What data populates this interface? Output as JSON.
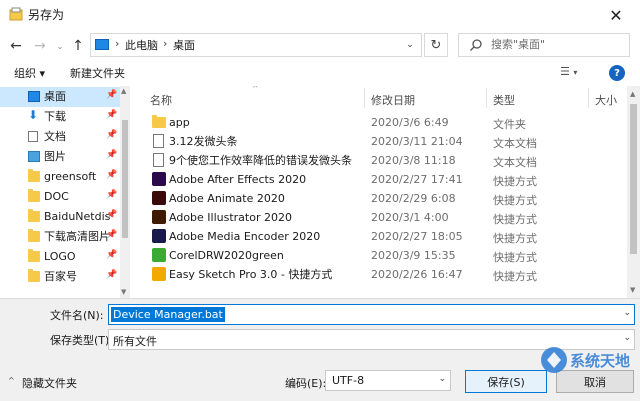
{
  "window": {
    "title": "另存为"
  },
  "nav": {
    "back_icon": "back-arrow-icon",
    "forward_icon": "forward-arrow-icon",
    "recent_icon": "chevron-down-icon",
    "up_icon": "up-arrow-icon",
    "breadcrumb": [
      "此电脑",
      "桌面"
    ],
    "search_placeholder": "搜索\"桌面\""
  },
  "toolbar": {
    "organize": "组织 ▾",
    "new_folder": "新建文件夹"
  },
  "sidebar": {
    "items": [
      {
        "label": "桌面",
        "icon": "desktop-icon",
        "pinned": true,
        "selected": true
      },
      {
        "label": "下载",
        "icon": "download-icon",
        "pinned": true
      },
      {
        "label": "文档",
        "icon": "document-icon",
        "pinned": true
      },
      {
        "label": "图片",
        "icon": "picture-icon",
        "pinned": true
      },
      {
        "label": "greensoft",
        "icon": "folder-icon",
        "pinned": true
      },
      {
        "label": "DOC",
        "icon": "folder-icon",
        "pinned": true
      },
      {
        "label": "BaiduNetdis",
        "icon": "folder-icon",
        "pinned": true
      },
      {
        "label": "下载高清图片",
        "icon": "folder-icon",
        "pinned": true
      },
      {
        "label": "LOGO",
        "icon": "folder-icon",
        "pinned": true
      },
      {
        "label": "百家号",
        "icon": "folder-icon",
        "pinned": true
      }
    ]
  },
  "columns": {
    "name": "名称",
    "date": "修改日期",
    "type": "类型",
    "size": "大小"
  },
  "files": [
    {
      "name": "app",
      "date": "2020/3/6 6:49",
      "type": "文件夹",
      "icon": "folder-icon",
      "color": "#f7c948"
    },
    {
      "name": "3.12发微头条",
      "date": "2020/3/11 21:04",
      "type": "文本文档",
      "icon": "text-file-icon",
      "color": "#ffffff"
    },
    {
      "name": "9个使您工作效率降低的错误发微头条",
      "date": "2020/3/8 11:18",
      "type": "文本文档",
      "icon": "text-file-icon",
      "color": "#ffffff"
    },
    {
      "name": "Adobe After Effects 2020",
      "date": "2020/2/27 17:41",
      "type": "快捷方式",
      "icon": "after-effects-icon",
      "color": "#2a0a4a"
    },
    {
      "name": "Adobe Animate 2020",
      "date": "2020/2/29 6:08",
      "type": "快捷方式",
      "icon": "animate-icon",
      "color": "#3a0a0a"
    },
    {
      "name": "Adobe Illustrator 2020",
      "date": "2020/3/1 4:00",
      "type": "快捷方式",
      "icon": "illustrator-icon",
      "color": "#3d1a00"
    },
    {
      "name": "Adobe Media Encoder 2020",
      "date": "2020/2/27 18:05",
      "type": "快捷方式",
      "icon": "media-encoder-icon",
      "color": "#1a1a4a"
    },
    {
      "name": "CorelDRW2020green",
      "date": "2020/3/9 15:35",
      "type": "快捷方式",
      "icon": "coreldraw-icon",
      "color": "#3aaa35"
    },
    {
      "name": "Easy Sketch Pro 3.0 - 快捷方式",
      "date": "2020/2/26 16:47",
      "type": "快捷方式",
      "icon": "sketch-icon",
      "color": "#f2a900"
    }
  ],
  "form": {
    "filename_label": "文件名(N):",
    "filename_value": "Device Manager.bat",
    "type_label": "保存类型(T):",
    "type_value": "所有文件",
    "encoding_label": "编码(E):",
    "encoding_value": "UTF-8",
    "save": "保存(S)",
    "cancel": "取消",
    "hide_folders": "隐藏文件夹"
  },
  "colors": {
    "accent": "#0078d7",
    "selected_bg": "#cce8ff"
  },
  "watermark": {
    "text": "系统天地"
  }
}
